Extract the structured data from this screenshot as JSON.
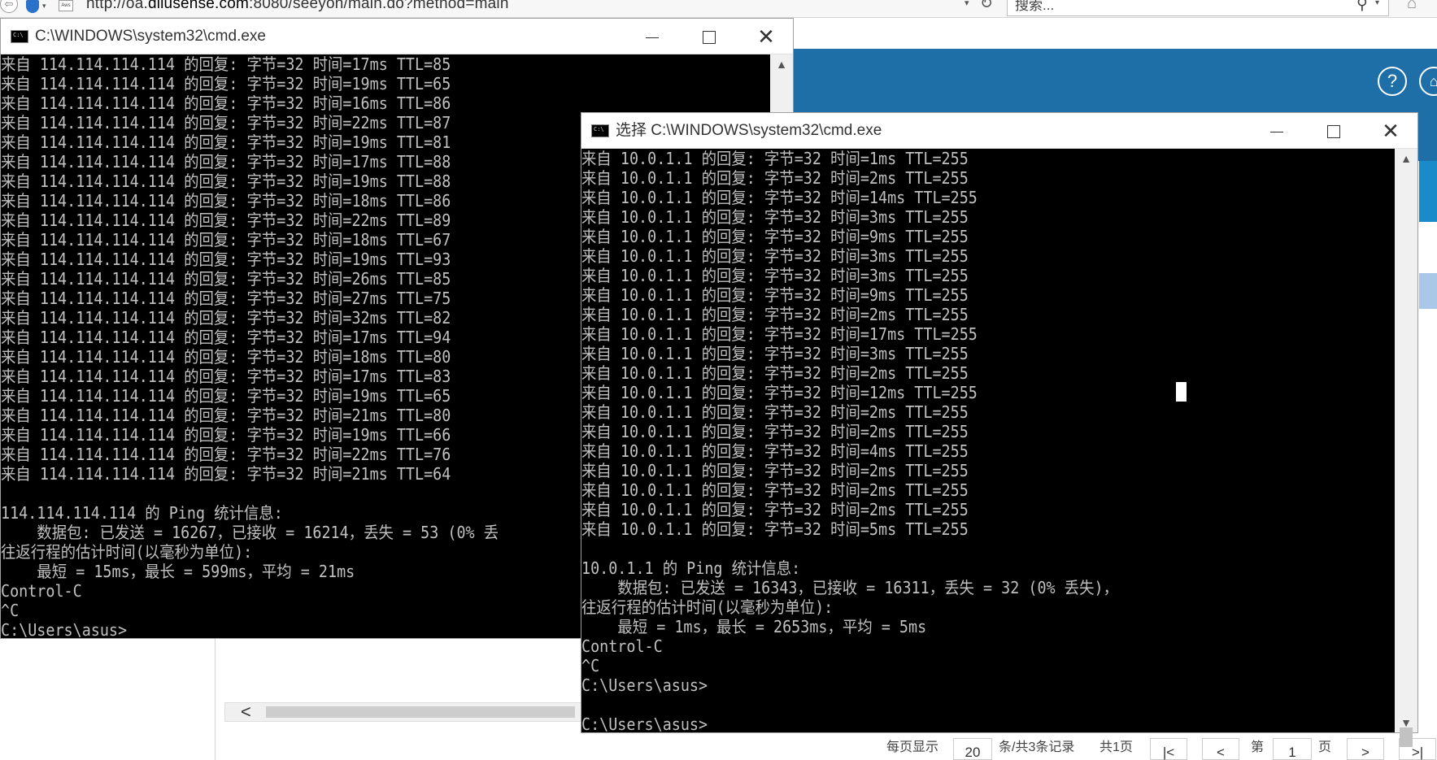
{
  "browser": {
    "url_prefix": "http://oa.",
    "url_domain": "dilusense.com",
    "url_rest": ":8080/seeyon/main.do?method=main",
    "search_placeholder": "搜索...",
    "back_glyph": "⇦",
    "shield_caret": "▾",
    "page_icon_text": "Aws"
  },
  "oa_page": {
    "help_glyph": "?",
    "home_glyph": "⌂",
    "pager": {
      "per_page_label": "每页显示",
      "per_page_value": "20",
      "records_label": "条/共3条记录",
      "pages_label": "共1页",
      "first_glyph": "|<",
      "prev_glyph": "<",
      "page_prefix": "第",
      "page_value": "1",
      "page_suffix": "页",
      "next_glyph": ">",
      "last_glyph": ">|"
    },
    "hscroll_left_glyph": "<"
  },
  "window1": {
    "title": "C:\\WINDOWS\\system32\\cmd.exe",
    "min_glyph": "",
    "close_glyph": "✕",
    "scroll_up_glyph": "▲",
    "lines": [
      "来自 114.114.114.114 的回复: 字节=32 时间=17ms TTL=85",
      "来自 114.114.114.114 的回复: 字节=32 时间=19ms TTL=65",
      "来自 114.114.114.114 的回复: 字节=32 时间=16ms TTL=86",
      "来自 114.114.114.114 的回复: 字节=32 时间=22ms TTL=87",
      "来自 114.114.114.114 的回复: 字节=32 时间=19ms TTL=81",
      "来自 114.114.114.114 的回复: 字节=32 时间=17ms TTL=88",
      "来自 114.114.114.114 的回复: 字节=32 时间=19ms TTL=88",
      "来自 114.114.114.114 的回复: 字节=32 时间=18ms TTL=86",
      "来自 114.114.114.114 的回复: 字节=32 时间=22ms TTL=89",
      "来自 114.114.114.114 的回复: 字节=32 时间=18ms TTL=67",
      "来自 114.114.114.114 的回复: 字节=32 时间=19ms TTL=93",
      "来自 114.114.114.114 的回复: 字节=32 时间=26ms TTL=85",
      "来自 114.114.114.114 的回复: 字节=32 时间=27ms TTL=75",
      "来自 114.114.114.114 的回复: 字节=32 时间=32ms TTL=82",
      "来自 114.114.114.114 的回复: 字节=32 时间=17ms TTL=94",
      "来自 114.114.114.114 的回复: 字节=32 时间=18ms TTL=80",
      "来自 114.114.114.114 的回复: 字节=32 时间=17ms TTL=83",
      "来自 114.114.114.114 的回复: 字节=32 时间=19ms TTL=65",
      "来自 114.114.114.114 的回复: 字节=32 时间=21ms TTL=80",
      "来自 114.114.114.114 的回复: 字节=32 时间=19ms TTL=66",
      "来自 114.114.114.114 的回复: 字节=32 时间=22ms TTL=76",
      "来自 114.114.114.114 的回复: 字节=32 时间=21ms TTL=64",
      "",
      "114.114.114.114 的 Ping 统计信息:",
      "    数据包: 已发送 = 16267，已接收 = 16214，丢失 = 53 (0% 丢",
      "往返行程的估计时间(以毫秒为单位):",
      "    最短 = 15ms，最长 = 599ms，平均 = 21ms",
      "Control-C",
      "^C",
      "C:\\Users\\asus>"
    ]
  },
  "window2": {
    "title": "选择 C:\\WINDOWS\\system32\\cmd.exe",
    "close_glyph": "✕",
    "scroll_up_glyph": "▲",
    "scroll_down_glyph": "▼",
    "lines": [
      "来自 10.0.1.1 的回复: 字节=32 时间=1ms TTL=255",
      "来自 10.0.1.1 的回复: 字节=32 时间=2ms TTL=255",
      "来自 10.0.1.1 的回复: 字节=32 时间=14ms TTL=255",
      "来自 10.0.1.1 的回复: 字节=32 时间=3ms TTL=255",
      "来自 10.0.1.1 的回复: 字节=32 时间=9ms TTL=255",
      "来自 10.0.1.1 的回复: 字节=32 时间=3ms TTL=255",
      "来自 10.0.1.1 的回复: 字节=32 时间=3ms TTL=255",
      "来自 10.0.1.1 的回复: 字节=32 时间=9ms TTL=255",
      "来自 10.0.1.1 的回复: 字节=32 时间=2ms TTL=255",
      "来自 10.0.1.1 的回复: 字节=32 时间=17ms TTL=255",
      "来自 10.0.1.1 的回复: 字节=32 时间=3ms TTL=255",
      "来自 10.0.1.1 的回复: 字节=32 时间=2ms TTL=255",
      "来自 10.0.1.1 的回复: 字节=32 时间=12ms TTL=255",
      "来自 10.0.1.1 的回复: 字节=32 时间=2ms TTL=255",
      "来自 10.0.1.1 的回复: 字节=32 时间=2ms TTL=255",
      "来自 10.0.1.1 的回复: 字节=32 时间=4ms TTL=255",
      "来自 10.0.1.1 的回复: 字节=32 时间=2ms TTL=255",
      "来自 10.0.1.1 的回复: 字节=32 时间=2ms TTL=255",
      "来自 10.0.1.1 的回复: 字节=32 时间=2ms TTL=255",
      "来自 10.0.1.1 的回复: 字节=32 时间=5ms TTL=255",
      "",
      "10.0.1.1 的 Ping 统计信息:",
      "    数据包: 已发送 = 16343，已接收 = 16311，丢失 = 32 (0% 丢失)，",
      "往返行程的估计时间(以毫秒为单位):",
      "    最短 = 1ms，最长 = 2653ms，平均 = 5ms",
      "Control-C",
      "^C",
      "C:\\Users\\asus>",
      "",
      "C:\\Users\\asus>"
    ]
  }
}
